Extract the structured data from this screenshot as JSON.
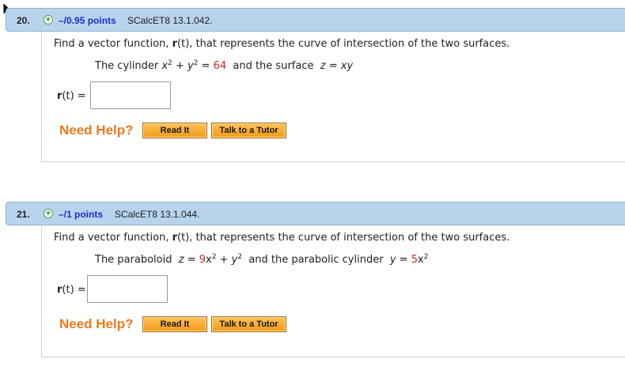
{
  "questions": [
    {
      "number": "20.",
      "points": "–/0.95 points",
      "source": "SCalcET8 13.1.042.",
      "prompt_pre": "Find a vector function, ",
      "prompt_r": "r",
      "prompt_t": "(t)",
      "prompt_post": ", that represents the curve of intersection of the two surfaces.",
      "eq": {
        "s1": "The cylinder ",
        "s2": "x",
        "s3": "2",
        "s4": " + ",
        "s5": "y",
        "s6": "2",
        "s7": " = ",
        "s8": "64",
        "s9": "  and the surface  ",
        "s10": "z",
        "s11": " = ",
        "s12": "xy",
        "s13": ""
      },
      "answer_label_r": "r",
      "answer_label_rest": "(t) =",
      "answer_value": "",
      "need_help": "Need Help?",
      "read_it": "Read It",
      "talk_tutor": "Talk to a Tutor"
    },
    {
      "number": "21.",
      "points": "–/1 points",
      "source": "SCalcET8 13.1.044.",
      "prompt_pre": "Find a vector function, ",
      "prompt_r": "r",
      "prompt_t": "(t)",
      "prompt_post": ", that represents the curve of intersection of the two surfaces.",
      "eq": {
        "s1": "The paraboloid  ",
        "s2": "z",
        "s3": " = ",
        "s4": "9",
        "s5": "x",
        "s6": "2",
        "s7": " + ",
        "s8": "y",
        "s9": "2",
        "s10": "  and the parabolic cylinder  ",
        "s11": "y",
        "s12": " = ",
        "s13": "5",
        "s14": "x",
        "s15": "2"
      },
      "answer_label_r": "r",
      "answer_label_rest": "(t) =",
      "answer_value": "",
      "need_help": "Need Help?",
      "read_it": "Read It",
      "talk_tutor": "Talk to a Tutor"
    }
  ],
  "colors": {
    "header_bg": "#b9d3ec",
    "points": "#1a2fc9",
    "given_value": "#c0282a",
    "need_help": "#e87b1e",
    "button": "#f39a14"
  },
  "icons": {
    "expand": "plus-circle-icon",
    "pointer": "mouse-cursor-icon"
  }
}
